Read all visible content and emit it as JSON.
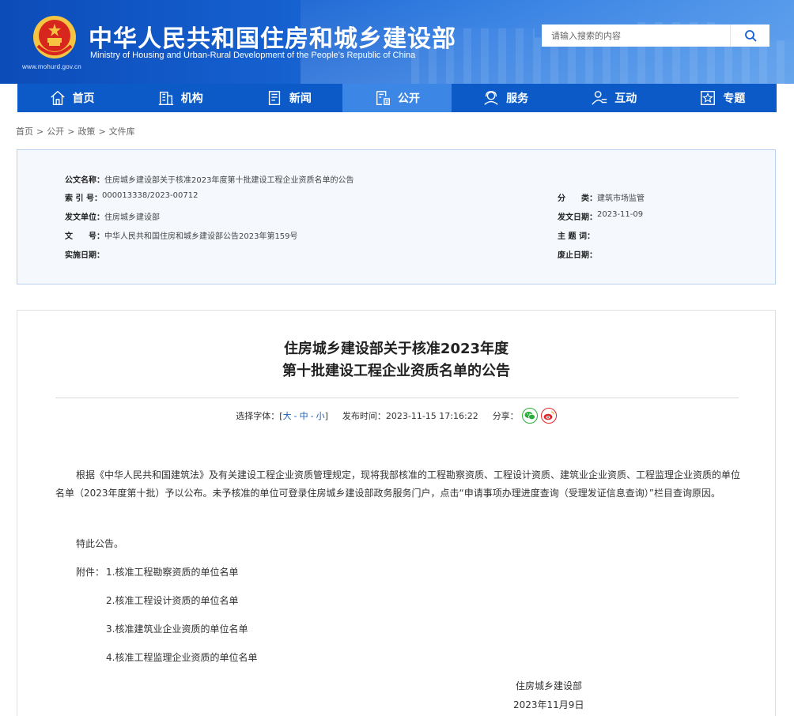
{
  "header": {
    "title_cn": "中华人民共和国住房和城乡建设部",
    "title_en": "Ministry of Housing and Urban-Rural Development of the People’s Republic of China",
    "site_url": "www.mohurd.gov.cn",
    "search_placeholder": "请输入搜索的内容"
  },
  "nav": [
    {
      "label": "首页",
      "icon": "home-icon"
    },
    {
      "label": "机构",
      "icon": "building-icon"
    },
    {
      "label": "新闻",
      "icon": "news-icon"
    },
    {
      "label": "公开",
      "icon": "document-icon"
    },
    {
      "label": "服务",
      "icon": "service-icon"
    },
    {
      "label": "互动",
      "icon": "interaction-icon"
    },
    {
      "label": "专题",
      "icon": "star-icon"
    }
  ],
  "breadcrumb": [
    "首页",
    "公开",
    "政策",
    "文件库"
  ],
  "info": {
    "doc_name_label": "公文名称：",
    "doc_name": "住房城乡建设部关于核准2023年度第十批建设工程企业资质名单的公告",
    "index_label": "索 引 号：",
    "index": "000013338/2023-00712",
    "category_label": "分　　类：",
    "category": "建筑市场监管",
    "issuer_label": "发文单位：",
    "issuer": "住房城乡建设部",
    "issue_date_label": "发文日期：",
    "issue_date": "2023-11-09",
    "doc_no_label": "文　　号：",
    "doc_no": "中华人民共和国住房和城乡建设部公告2023年第159号",
    "subject_label": "主 题 词：",
    "subject": "",
    "effective_label": "实施日期：",
    "effective": "",
    "expiry_label": "废止日期：",
    "expiry": ""
  },
  "article": {
    "title_line1": "住房城乡建设部关于核准2023年度",
    "title_line2": "第十批建设工程企业资质名单的公告",
    "font_label": "选择字体：",
    "bracket_open": "[",
    "size_large": "大",
    "size_medium": "中",
    "size_small": "小",
    "bracket_close": "]",
    "dash": "-",
    "publish_label": "发布时间：",
    "publish_time": "2023-11-15 17:16:22",
    "share_label": "分享：",
    "body": "根据《中华人民共和国建筑法》及有关建设工程企业资质管理规定，现将我部核准的工程勘察资质、工程设计资质、建筑业企业资质、工程监理企业资质的单位名单（2023年度第十批）予以公布。未予核准的单位可登录住房城乡建设部政务服务门户，点击“申请事项办理进度查询（受理发证信息查询）”栏目查询原因。",
    "notice": "特此公告。",
    "attachments_label": "附件：",
    "attachments": [
      "1.核准工程勘察资质的单位名单",
      "2.核准工程设计资质的单位名单",
      "3.核准建筑业企业资质的单位名单",
      "4.核准工程监理企业资质的单位名单"
    ],
    "signer": "住房城乡建设部",
    "sign_date": "2023年11月9日"
  },
  "colors": {
    "nav_bg": "#0b5ac8",
    "nav_active": "#3c86e6",
    "info_bg": "#f5f9fe",
    "info_border": "#b9d0ee",
    "link": "#1a5fb4"
  }
}
